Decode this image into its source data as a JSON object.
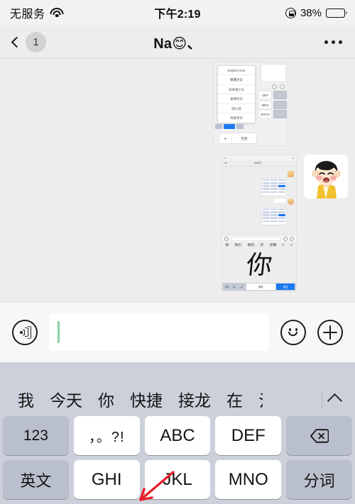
{
  "status_bar": {
    "carrier": "无服务",
    "wifi_icon": "wifi-icon",
    "time": "下午2:19",
    "rotation_lock_icon": "rotation-lock-icon",
    "battery_percent": "38%",
    "battery_level": 38
  },
  "nav_bar": {
    "back_icon": "chevron-left-icon",
    "unread_count": "1",
    "title": "Na😊、",
    "more_icon": "more-dots-icon"
  },
  "chat": {
    "background_color": "#ededed",
    "messages": [
      {
        "type": "image",
        "name": "keyboard-language-menu-screenshot",
        "content": {
          "language_list": [
            "English (US)",
            "繁體注音",
            "日本語かな",
            "表情符号",
            "四川话",
            "简体手写"
          ],
          "keys": [
            "DEF",
            "MNO",
            "WXYZ"
          ],
          "space_key": "空格",
          "mic_key": "mic-icon"
        }
      },
      {
        "type": "image",
        "name": "handwriting-chat-screenshot",
        "content": {
          "title": "Na😊、",
          "candidates": [
            "你",
            "你们",
            "你的",
            "仔",
            "仔细",
            "f",
            "☺"
          ],
          "handwritten_char": "你",
          "bottom_keys": [
            "123",
            "⊕",
            "mic-icon"
          ],
          "space_label": "退格",
          "send_label": "发送"
        }
      },
      {
        "type": "sticker",
        "name": "maruko-chan-sticker",
        "description": "卡通女孩贴图"
      }
    ]
  },
  "input_bar": {
    "voice_icon": "voice-input-icon",
    "text_value": "",
    "placeholder": "",
    "emoji_icon": "emoji-smiley-icon",
    "plus_icon": "plus-icon",
    "caret_color": "#88d3a0"
  },
  "keyboard": {
    "background_color": "#ccd0da",
    "prediction_bar": {
      "items": [
        "我",
        "今天",
        "你",
        "快捷",
        "接龙",
        "在",
        "氵"
      ],
      "expand_icon": "chevron-up-icon"
    },
    "rows": [
      [
        {
          "label": "123",
          "type": "fn",
          "name": "key-123"
        },
        {
          "label": "，。?!",
          "type": "normal",
          "name": "key-punctuation"
        },
        {
          "label": "ABC",
          "type": "normal",
          "name": "key-abc"
        },
        {
          "label": "DEF",
          "type": "normal",
          "name": "key-def"
        },
        {
          "label": "⌫",
          "type": "fn",
          "name": "key-backspace"
        }
      ],
      [
        {
          "label": "英文",
          "type": "fn",
          "name": "key-english"
        },
        {
          "label": "GHI",
          "type": "normal",
          "name": "key-ghi"
        },
        {
          "label": "JKL",
          "type": "normal",
          "name": "key-jkl"
        },
        {
          "label": "MNO",
          "type": "normal",
          "name": "key-mno"
        },
        {
          "label": "分词",
          "type": "fn",
          "name": "key-segment"
        }
      ]
    ]
  },
  "annotation": {
    "arrow_color": "#e8202a",
    "arrow_target": "key-jkl"
  }
}
